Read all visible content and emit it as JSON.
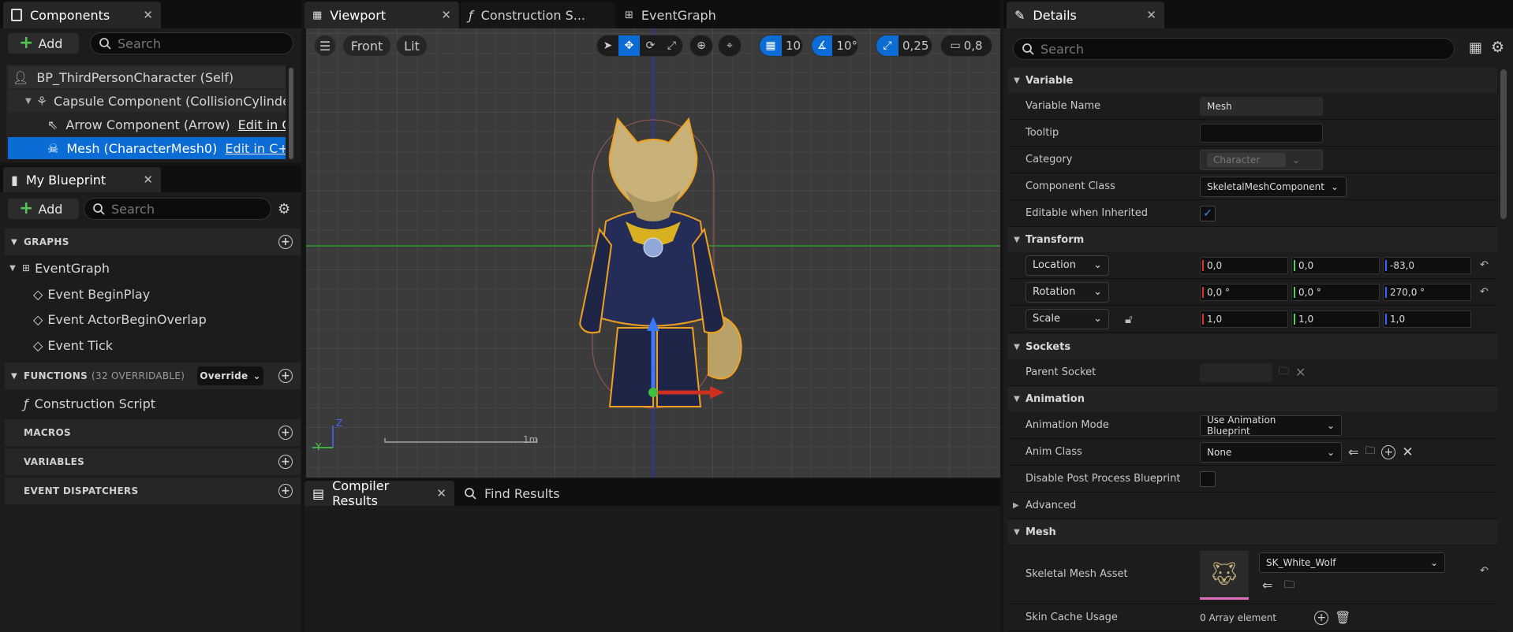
{
  "components_panel": {
    "tab_title": "Components",
    "add_label": "Add",
    "search_placeholder": "Search",
    "tree": [
      {
        "label": "BP_ThirdPersonCharacter (Self)",
        "link": ""
      },
      {
        "label": "Capsule Component (CollisionCylinder)",
        "link": ""
      },
      {
        "label": "Arrow Component (Arrow)",
        "link": "Edit in C++"
      },
      {
        "label": "Mesh (CharacterMesh0)",
        "link": "Edit in C++"
      }
    ]
  },
  "my_blueprint": {
    "tab_title": "My Blueprint",
    "add_label": "Add",
    "search_placeholder": "Search",
    "graphs_header": "GRAPHS",
    "event_graph": "EventGraph",
    "events": [
      "Event BeginPlay",
      "Event ActorBeginOverlap",
      "Event Tick"
    ],
    "functions_header": "FUNCTIONS",
    "functions_overridable": "(32 OVERRIDABLE)",
    "override_label": "Override",
    "construction_script": "Construction Script",
    "macros_header": "MACROS",
    "variables_header": "VARIABLES",
    "dispatchers_header": "EVENT DISPATCHERS"
  },
  "center_tabs": [
    {
      "label": "Viewport"
    },
    {
      "label": "Construction S..."
    },
    {
      "label": "EventGraph"
    }
  ],
  "viewport": {
    "view_mode": "Front",
    "lit_mode": "Lit",
    "grid_snap": "10",
    "rotation_snap": "10°",
    "scale_snap": "0,25",
    "camera_speed": "0,8",
    "scale_label": "1m",
    "axis_z": "Z",
    "axis_y": "Y"
  },
  "bottom_tabs": [
    {
      "label": "Compiler Results"
    },
    {
      "label": "Find Results"
    }
  ],
  "details": {
    "tab_title": "Details",
    "search_placeholder": "Search",
    "sections": {
      "variable": "Variable",
      "transform": "Transform",
      "sockets": "Sockets",
      "animation": "Animation",
      "advanced": "Advanced",
      "mesh": "Mesh"
    },
    "variable_name_label": "Variable Name",
    "variable_name_value": "Mesh",
    "tooltip_label": "Tooltip",
    "category_label": "Category",
    "category_value": "Character",
    "component_class_label": "Component Class",
    "component_class_value": "SkeletalMeshComponent",
    "editable_label": "Editable when Inherited",
    "editable_checked": true,
    "location_label": "Location",
    "location": [
      "0,0",
      "0,0",
      "-83,0"
    ],
    "rotation_label": "Rotation",
    "rotation": [
      "0,0 °",
      "0,0 °",
      "270,0 °"
    ],
    "scale_label": "Scale",
    "scale": [
      "1,0",
      "1,0",
      "1,0"
    ],
    "parent_socket_label": "Parent Socket",
    "anim_mode_label": "Animation Mode",
    "anim_mode_value": "Use Animation Blueprint",
    "anim_class_label": "Anim Class",
    "anim_class_value": "None",
    "disable_pp_label": "Disable Post Process Blueprint",
    "skeletal_mesh_label": "Skeletal Mesh Asset",
    "skeletal_mesh_value": "SK_White_Wolf",
    "skin_cache_label": "Skin Cache Usage",
    "skin_cache_value": "0 Array element"
  },
  "colors": {
    "accent_blue": "#0a6cd4",
    "add_green": "#54c454",
    "axis_x": "#d33",
    "axis_y": "#5c5",
    "axis_z": "#36f"
  }
}
